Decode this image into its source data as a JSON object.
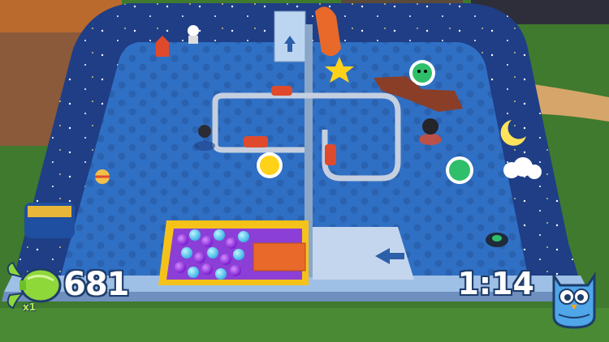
{
  "hud": {
    "score": "681",
    "multiplier": "x1",
    "timer": "1:14",
    "score_icon": "green-candy-icon",
    "timer_icon": "blue-owl-mascot-icon"
  },
  "colors": {
    "grass": "#3f7a2e",
    "pool_floor": "#2f68b8",
    "pool_floor_dark": "#2a5ca6",
    "wall": "#5e9be0",
    "rim": "#9fc0e6",
    "ball_pit_frame": "#f5c21a",
    "track": "#b8c4d6",
    "accent_red": "#e04a2c",
    "accent_green": "#2fbf6b",
    "hud_outline": "#1e3d6b"
  },
  "icons": [
    "rocket-icon",
    "astronaut-icon",
    "blue-box-arrow-icon",
    "orange-dinosaur-icon",
    "yellow-star-icon",
    "green-monster-badge-icon",
    "sun-badge-icon",
    "green-bug-badge-icon",
    "ufo-icon",
    "ball-icon",
    "toy-car-icon",
    "moon-icon",
    "cloud-icon",
    "bathtub-icon"
  ]
}
